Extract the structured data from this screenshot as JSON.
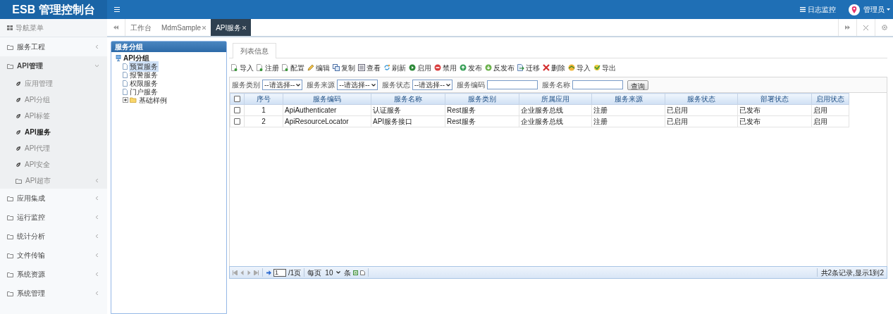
{
  "header": {
    "logo": "ESB 管理控制台",
    "log_link": "日志监控",
    "user": "管理员"
  },
  "sidebar": {
    "title": "导航菜单",
    "items": [
      {
        "label": "服务工程",
        "kind": "folder",
        "expanded": false,
        "selected": false
      },
      {
        "label": "API管理",
        "kind": "folder",
        "expanded": true,
        "selected": false,
        "children": [
          {
            "label": "应用管理",
            "kind": "leaf",
            "selected": false
          },
          {
            "label": "API分组",
            "kind": "leaf",
            "selected": false
          },
          {
            "label": "API标签",
            "kind": "leaf",
            "selected": false
          },
          {
            "label": "API服务",
            "kind": "leaf",
            "selected": true
          },
          {
            "label": "API代理",
            "kind": "leaf",
            "selected": false
          },
          {
            "label": "API安全",
            "kind": "leaf",
            "selected": false
          },
          {
            "label": "API超市",
            "kind": "folder",
            "expanded": false,
            "selected": false
          }
        ]
      },
      {
        "label": "应用集成",
        "kind": "folder",
        "expanded": false,
        "selected": false
      },
      {
        "label": "运行监控",
        "kind": "folder",
        "expanded": false,
        "selected": false
      },
      {
        "label": "统计分析",
        "kind": "folder",
        "expanded": false,
        "selected": false
      },
      {
        "label": "文件传输",
        "kind": "folder",
        "expanded": false,
        "selected": false
      },
      {
        "label": "系统资源",
        "kind": "folder",
        "expanded": false,
        "selected": false
      },
      {
        "label": "系统管理",
        "kind": "folder",
        "expanded": false,
        "selected": false
      }
    ]
  },
  "tabs": [
    {
      "label": "工作台",
      "closable": false,
      "selected": false
    },
    {
      "label": "MdmSample",
      "closable": true,
      "selected": false
    },
    {
      "label": "API服务",
      "closable": true,
      "selected": true
    }
  ],
  "group_panel": {
    "title": "服务分组",
    "tree": [
      {
        "label": "API分组",
        "kind": "root",
        "children": [
          {
            "label": "预置服务",
            "kind": "doc",
            "selected": true
          },
          {
            "label": "报警服务",
            "kind": "doc",
            "selected": false
          },
          {
            "label": "权限服务",
            "kind": "doc",
            "selected": false
          },
          {
            "label": "门户服务",
            "kind": "doc",
            "selected": false
          },
          {
            "label": "基础样例",
            "kind": "folder",
            "expanded": false,
            "selected": false
          }
        ]
      }
    ]
  },
  "content_tabs": [
    {
      "label": "列表信息",
      "selected": true
    }
  ],
  "toolbar": [
    {
      "label": "导入",
      "kind": "docadd"
    },
    {
      "label": "注册",
      "kind": "docadd"
    },
    {
      "label": "配置",
      "kind": "docadd"
    },
    {
      "label": "编辑",
      "kind": "pencil"
    },
    {
      "label": "复制",
      "kind": "copy"
    },
    {
      "label": "查看",
      "kind": "list"
    },
    {
      "label": "刷新",
      "kind": "refresh"
    },
    {
      "label": "启用",
      "kind": "play"
    },
    {
      "label": "禁用",
      "kind": "stop"
    },
    {
      "label": "发布",
      "kind": "up"
    },
    {
      "label": "反发布",
      "kind": "down"
    },
    {
      "label": "迁移",
      "kind": "move"
    },
    {
      "label": "删除",
      "kind": "delete"
    },
    {
      "label": "导入",
      "kind": "import"
    },
    {
      "label": "导出",
      "kind": "export"
    }
  ],
  "filters": [
    {
      "label": "服务类别",
      "kind": "select",
      "value": "--请选择--"
    },
    {
      "label": "服务来源",
      "kind": "select",
      "value": "--请选择--"
    },
    {
      "label": "服务状态",
      "kind": "select",
      "value": "--请选择--"
    },
    {
      "label": "服务编码",
      "kind": "text"
    },
    {
      "label": "服务名称",
      "kind": "text"
    }
  ],
  "query_button": "查询",
  "table": {
    "header_checked": false,
    "columns": [
      "序号",
      "服务编码",
      "服务名称",
      "服务类别",
      "所属应用",
      "服务来源",
      "服务状态",
      "部署状态",
      "启用状态"
    ],
    "rows": [
      {
        "checked": false,
        "cells": [
          "1",
          "ApiAuthenticater",
          "认证服务",
          "Rest服务",
          "企业服务总线",
          "注册",
          "已启用",
          "已发布",
          "启用"
        ]
      },
      {
        "checked": false,
        "cells": [
          "2",
          "ApiResourceLocator",
          "API服务接口",
          "Rest服务",
          "企业服务总线",
          "注册",
          "已启用",
          "已发布",
          "启用"
        ]
      }
    ]
  },
  "pager": {
    "page": "1",
    "pages": "/1页",
    "per_page_label": "每页",
    "per_page": "10",
    "unit": "条",
    "summary": "共2条记录,显示1到2"
  }
}
